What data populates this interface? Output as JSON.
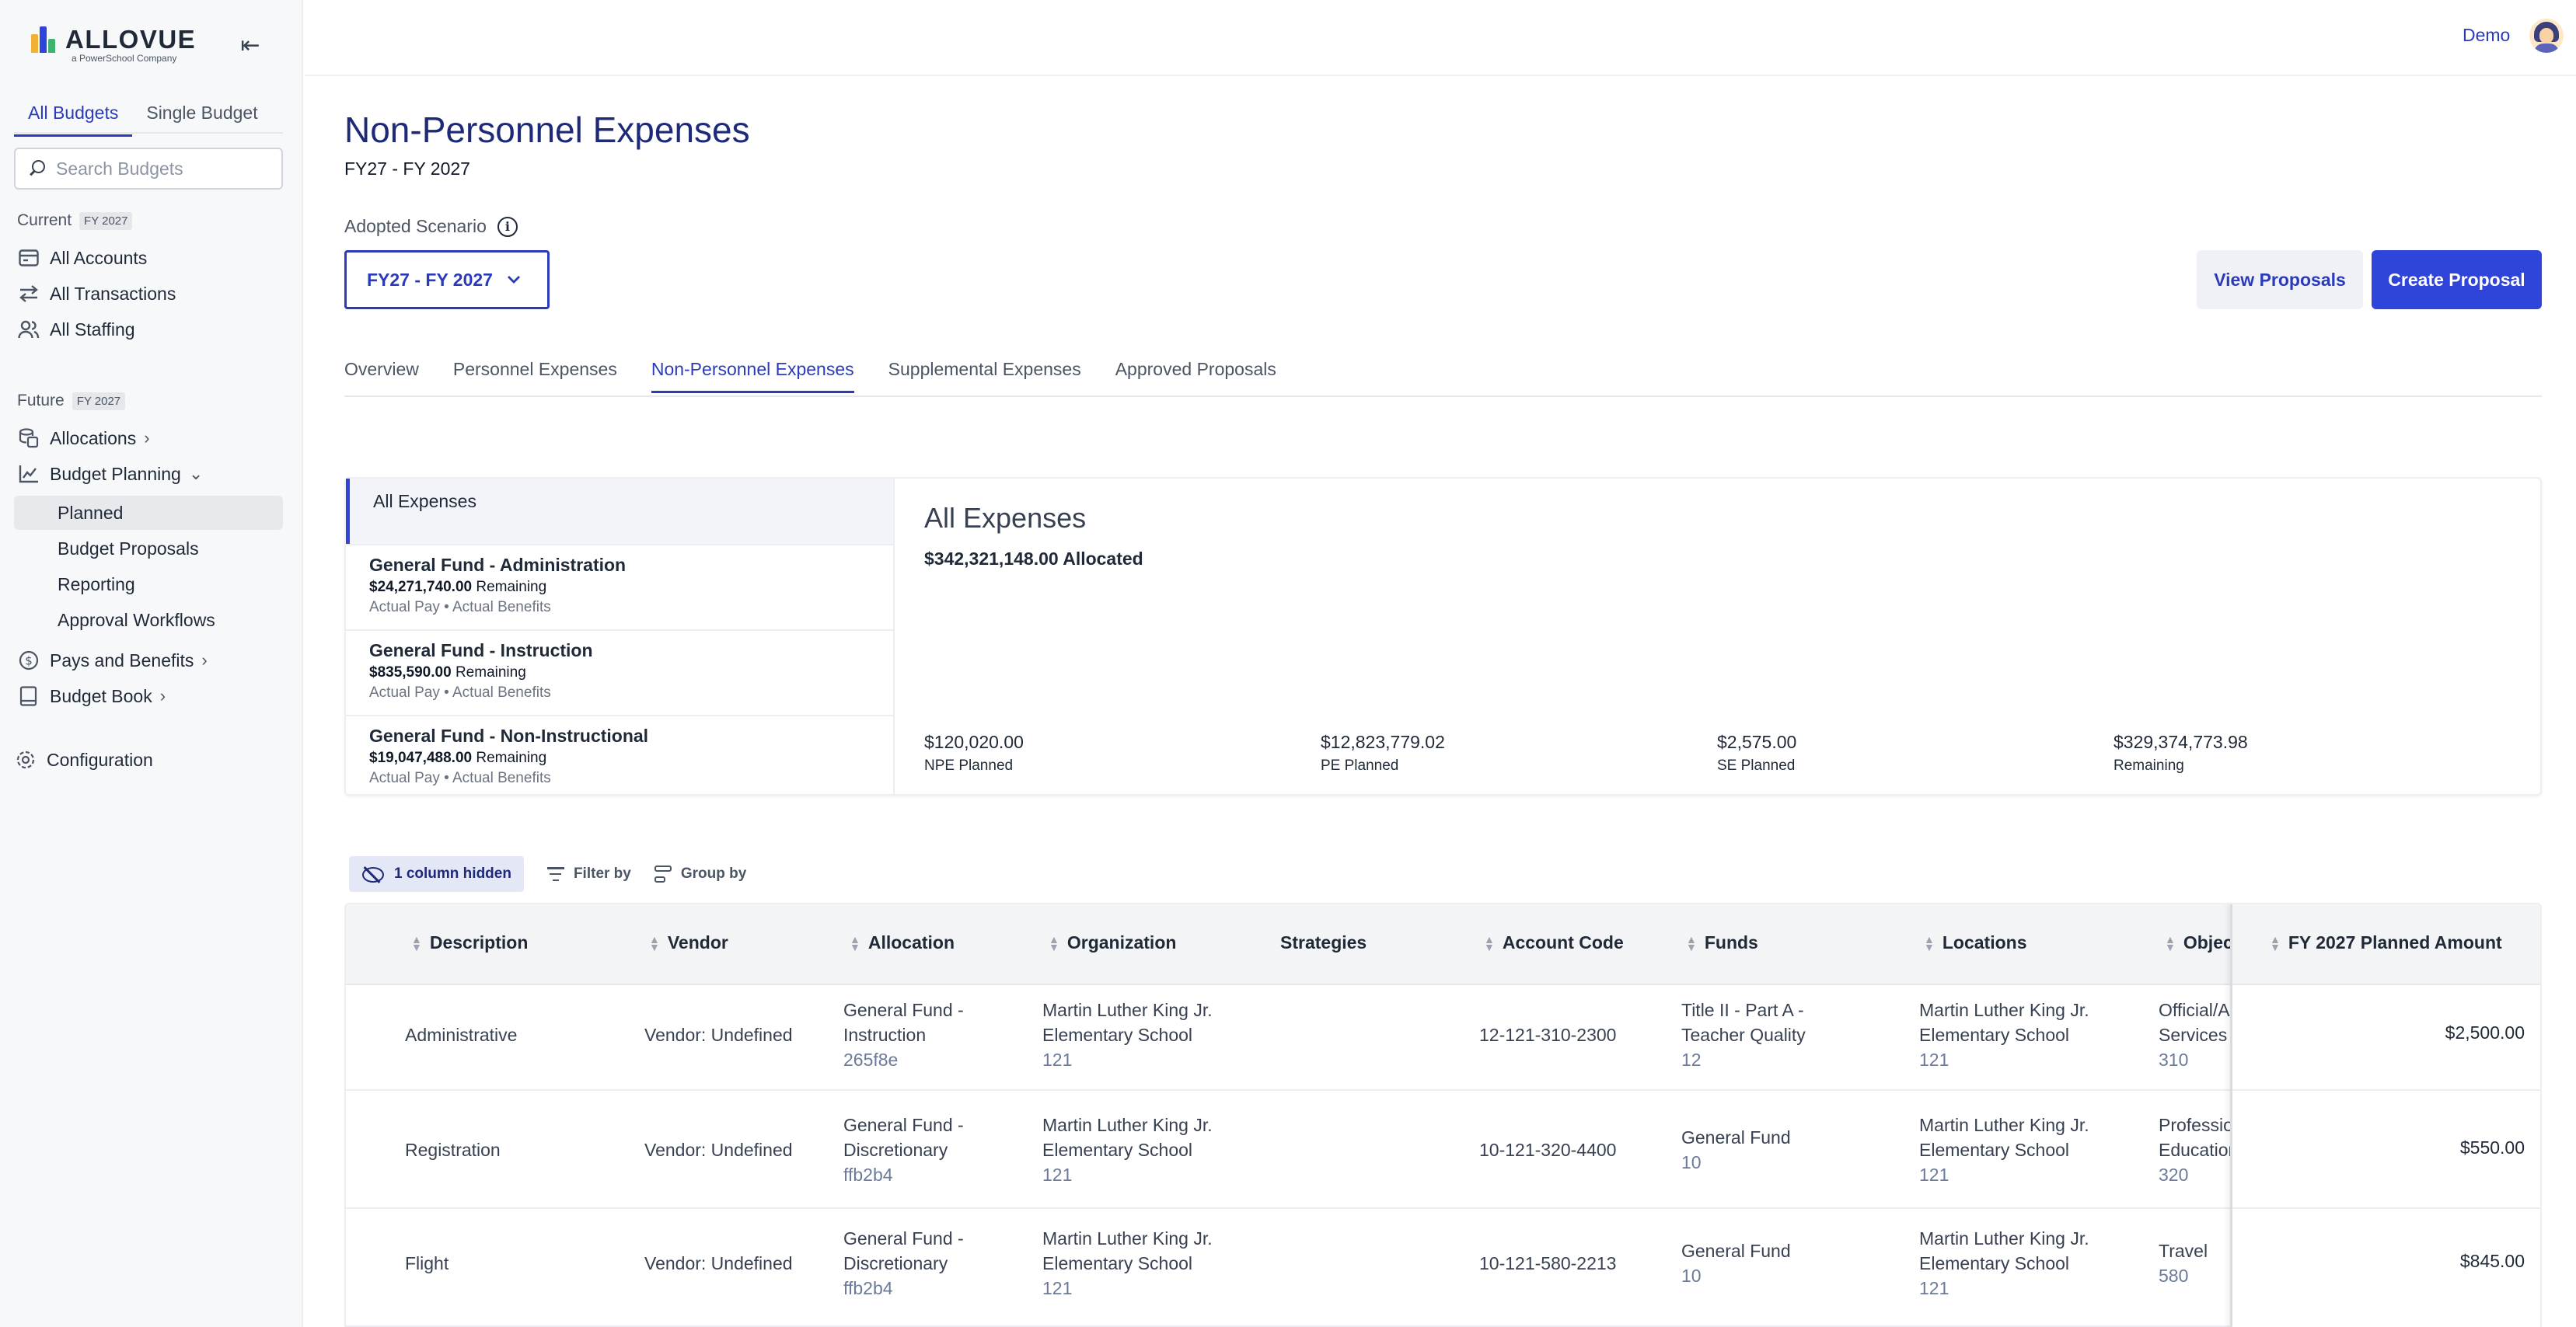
{
  "brand": {
    "name": "ALLOVUE",
    "sub": "a PowerSchool Company"
  },
  "sidebar": {
    "tabs": [
      "All Budgets",
      "Single Budget"
    ],
    "search_placeholder": "Search Budgets",
    "current_label": "Current",
    "current_fy": "FY 2027",
    "current_items": [
      "All Accounts",
      "All Transactions",
      "All Staffing"
    ],
    "future_label": "Future",
    "future_fy": "FY 2027",
    "allocations": "Allocations",
    "budget_planning": "Budget Planning",
    "planning_sub": [
      "Planned",
      "Budget Proposals",
      "Reporting",
      "Approval Workflows"
    ],
    "pays": "Pays and Benefits",
    "budget_book": "Budget Book",
    "configuration": "Configuration"
  },
  "header": {
    "user": "Demo"
  },
  "page": {
    "title": "Non-Personnel Expenses",
    "subtitle": "FY27 - FY 2027",
    "scenario_label": "Adopted Scenario",
    "scenario_value": "FY27 - FY 2027",
    "view_proposals": "View Proposals",
    "create_proposal": "Create Proposal",
    "tabs": [
      "Overview",
      "Personnel Expenses",
      "Non-Personnel Expenses",
      "Supplemental Expenses",
      "Approved Proposals"
    ]
  },
  "summary": {
    "all_label": "All Expenses",
    "funds": [
      {
        "name": "General Fund - Administration",
        "amount": "$24,271,740.00",
        "remaining": "Remaining",
        "tags": "Actual Pay • Actual Benefits"
      },
      {
        "name": "General Fund - Instruction",
        "amount": "$835,590.00",
        "remaining": "Remaining",
        "tags": "Actual Pay • Actual Benefits"
      },
      {
        "name": "General Fund - Non-Instructional",
        "amount": "$19,047,488.00",
        "remaining": "Remaining",
        "tags": "Actual Pay • Actual Benefits"
      }
    ],
    "title": "All Expenses",
    "allocated": "$342,321,148.00 Allocated",
    "stats": [
      {
        "value": "$120,020.00",
        "label": "NPE Planned"
      },
      {
        "value": "$12,823,779.02",
        "label": "PE Planned"
      },
      {
        "value": "$2,575.00",
        "label": "SE Planned"
      },
      {
        "value": "$329,374,773.98",
        "label": "Remaining"
      }
    ]
  },
  "toolbar": {
    "hidden": "1 column hidden",
    "filter": "Filter by",
    "group": "Group by"
  },
  "table": {
    "columns": [
      "Description",
      "Vendor",
      "Allocation",
      "Organization",
      "Strategies",
      "Account Code",
      "Funds",
      "Locations",
      "Object",
      "FY 2027 Planned Amount"
    ],
    "rows": [
      {
        "description": "Administrative",
        "vendor": "Vendor: Undefined",
        "allocation": [
          "General Fund -",
          "Instruction",
          "265f8e"
        ],
        "organization": [
          "Martin Luther King Jr.",
          "Elementary School",
          "121"
        ],
        "account": "12-121-310-2300",
        "funds": [
          "Title II - Part A -",
          "Teacher Quality",
          "12"
        ],
        "locations": [
          "Martin Luther King Jr.",
          "Elementary School",
          "121"
        ],
        "object": [
          "Official/Administrative",
          "Services",
          "310"
        ],
        "amount": "$2,500.00"
      },
      {
        "description": "Registration",
        "vendor": "Vendor: Undefined",
        "allocation": [
          "General Fund -",
          "Discretionary",
          "ffb2b4"
        ],
        "organization": [
          "Martin Luther King Jr.",
          "Elementary School",
          "121"
        ],
        "account": "10-121-320-4400",
        "funds": [
          "General Fund",
          "10"
        ],
        "locations": [
          "Martin Luther King Jr.",
          "Elementary School",
          "121"
        ],
        "object": [
          "Professional",
          "Educational",
          "320"
        ],
        "amount": "$550.00"
      },
      {
        "description": "Flight",
        "vendor": "Vendor: Undefined",
        "allocation": [
          "General Fund -",
          "Discretionary",
          "ffb2b4"
        ],
        "organization": [
          "Martin Luther King Jr.",
          "Elementary School",
          "121"
        ],
        "account": "10-121-580-2213",
        "funds": [
          "General Fund",
          "10"
        ],
        "locations": [
          "Martin Luther King Jr.",
          "Elementary School",
          "121"
        ],
        "object": [
          "Travel",
          "580"
        ],
        "amount": "$845.00"
      }
    ]
  },
  "colors": {
    "accent": "#2b3bb8",
    "primary_button": "#2f44d9",
    "title": "#1e2a78"
  }
}
